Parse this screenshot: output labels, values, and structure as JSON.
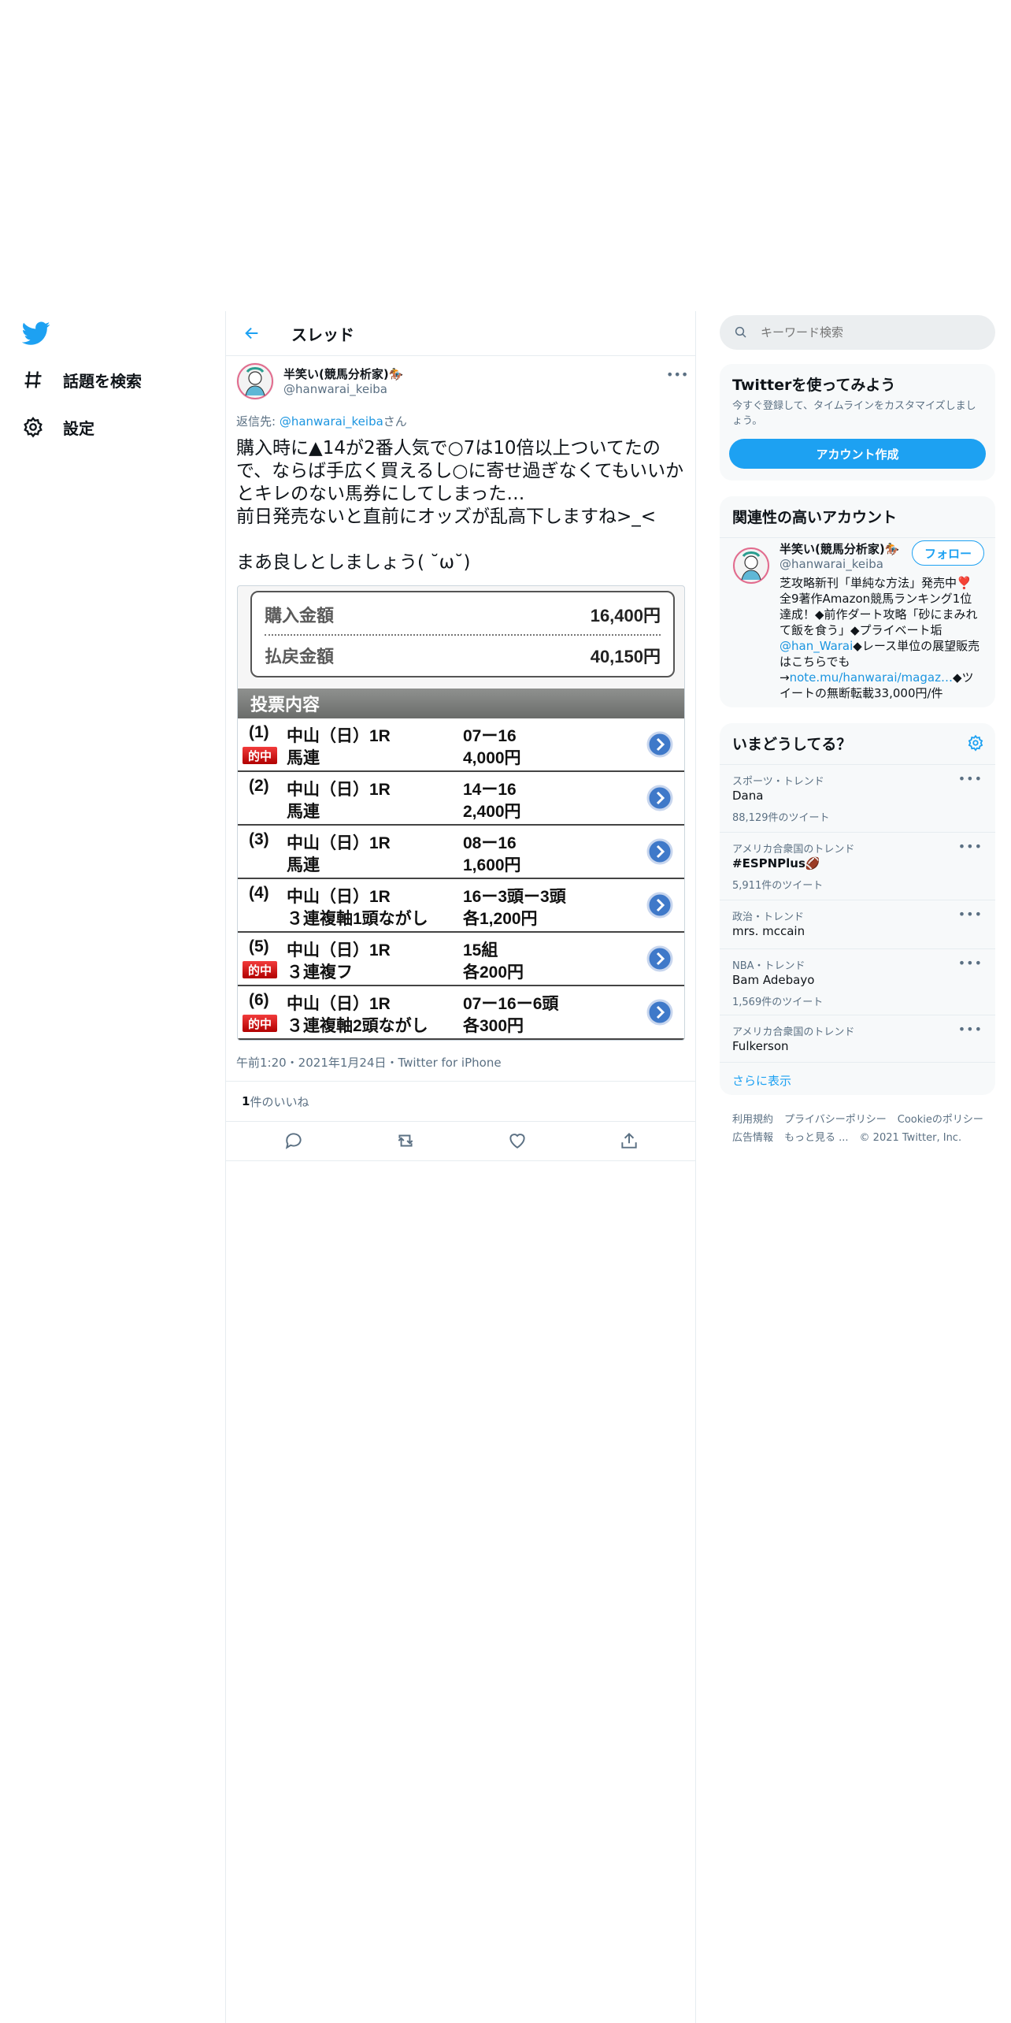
{
  "nav": {
    "explore_label": "話題を検索",
    "settings_label": "設定"
  },
  "header": {
    "title": "スレッド"
  },
  "tweet": {
    "author_name": "半笑い(競馬分析家)🏇",
    "author_handle": "@hanwarai_keiba",
    "reply_prefix": "返信先: ",
    "reply_to": "@hanwarai_keiba",
    "reply_suffix": "さん",
    "text": "購入時に▲14が2番人気で○7は10倍以上ついてたので、ならば手広く買えるし○に寄せ過ぎなくてもいいかとキレのない馬券にしてしまった…\n前日発売ないと直前にオッズが乱高下しますね>_<\n\nまあ良しとしましょう( ˘ω˘)",
    "timestamp": "午前1:20・2021年1月24日・Twitter for iPhone",
    "like_count": "1",
    "like_label": " 件のいいね"
  },
  "ticket": {
    "purchase_label": "購入金額",
    "purchase_amount": "16,400円",
    "payout_label": "払戻金額",
    "payout_amount": "40,150円",
    "section_title": "投票内容",
    "hit_label": "的中",
    "bets": [
      {
        "idx": "(1)",
        "race": "中山（日）1R",
        "type": "馬連",
        "combo": "07ー16",
        "amount": "4,000円",
        "hit": true
      },
      {
        "idx": "(2)",
        "race": "中山（日）1R",
        "type": "馬連",
        "combo": "14ー16",
        "amount": "2,400円",
        "hit": false
      },
      {
        "idx": "(3)",
        "race": "中山（日）1R",
        "type": "馬連",
        "combo": "08ー16",
        "amount": "1,600円",
        "hit": false
      },
      {
        "idx": "(4)",
        "race": "中山（日）1R",
        "type": "３連複軸1頭ながし",
        "combo": "16ー3頭ー3頭",
        "amount": "各1,200円",
        "hit": false
      },
      {
        "idx": "(5)",
        "race": "中山（日）1R",
        "type": "３連複フ",
        "combo": "15組",
        "amount": "各200円",
        "hit": true
      },
      {
        "idx": "(6)",
        "race": "中山（日）1R",
        "type": "３連複軸2頭ながし",
        "combo": "07ー16ー6頭",
        "amount": "各300円",
        "hit": true
      }
    ]
  },
  "search": {
    "placeholder": "キーワード検索"
  },
  "signup": {
    "title": "Twitterを使ってみよう",
    "description": "今すぐ登録して、タイムラインをカスタマイズしましょう。",
    "button": "アカウント作成"
  },
  "related": {
    "title": "関連性の高いアカウント",
    "name": "半笑い(競馬分析家)🏇",
    "handle": "@hanwarai_keiba",
    "follow": "フォロー",
    "bio_1": "芝攻略新刊「単純な方法」発売中❣️全9著作Amazon競馬ランキング1位達成！◆前作ダート攻略「砂にまみれて飯を食う」◆プライベート垢",
    "bio_link1": "@han_Warai",
    "bio_2": "◆レース単位の展望販売はこちらでも→",
    "bio_link2": "note.mu/hanwarai/magaz…",
    "bio_3": "◆ツイートの無断転載33,000円/件"
  },
  "trends": {
    "title": "いまどうしてる？",
    "items": [
      {
        "context": "スポーツ・トレンド",
        "name": "Dana",
        "count": "88,129件のツイート"
      },
      {
        "context": "アメリカ合衆国のトレンド",
        "name": "#ESPNPlus🏈",
        "count": "5,911件のツイート"
      },
      {
        "context": "政治・トレンド",
        "name": "mrs. mccain",
        "count": ""
      },
      {
        "context": "NBA・トレンド",
        "name": "Bam Adebayo",
        "count": "1,569件のツイート"
      },
      {
        "context": "アメリカ合衆国のトレンド",
        "name": "Fulkerson",
        "count": ""
      }
    ],
    "show_more": "さらに表示"
  },
  "footer": {
    "terms": "利用規約",
    "privacy": "プライバシーポリシー",
    "cookie": "Cookieのポリシー",
    "ads": "広告情報",
    "more": "もっと見る ...",
    "copyright": "© 2021 Twitter, Inc."
  },
  "colors": {
    "accent": "#1da1f2",
    "link": "#1b95e0",
    "muted": "#5b7083"
  }
}
